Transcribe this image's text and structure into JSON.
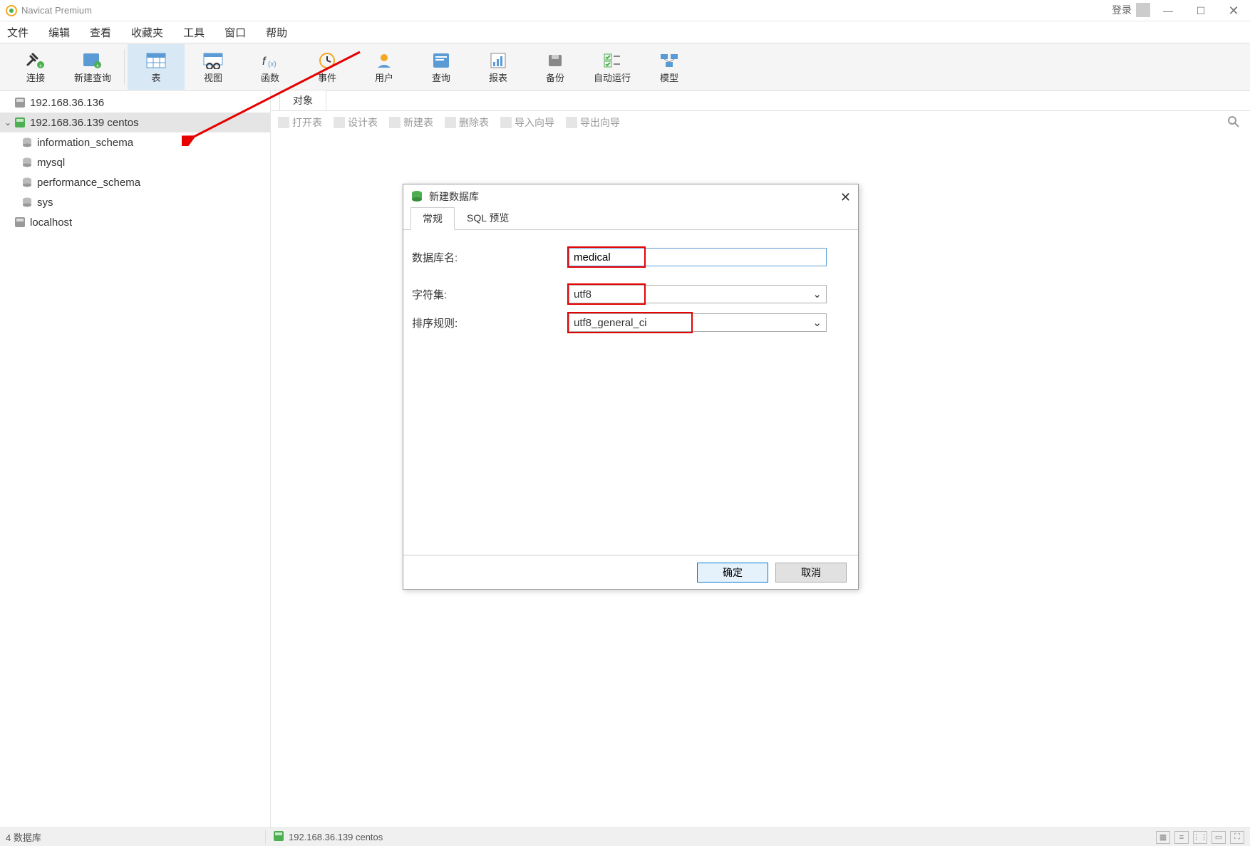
{
  "app": {
    "title": "Navicat Premium"
  },
  "login": {
    "label": "登录"
  },
  "menu": {
    "file": "文件",
    "edit": "编辑",
    "view": "查看",
    "fav": "收藏夹",
    "tools": "工具",
    "window": "窗口",
    "help": "帮助"
  },
  "toolbar": {
    "connect": "连接",
    "newquery": "新建查询",
    "table": "表",
    "view": "视图",
    "function": "函数",
    "event": "事件",
    "user": "用户",
    "query": "查询",
    "report": "报表",
    "backup": "备份",
    "autorun": "自动运行",
    "model": "模型"
  },
  "tree": {
    "conn1": "192.168.36.136",
    "conn2": "192.168.36.139  centos",
    "dbs": [
      "information_schema",
      "mysql",
      "performance_schema",
      "sys"
    ],
    "conn3": "localhost"
  },
  "objtab": "对象",
  "objtoolbar": {
    "open": "打开表",
    "design": "设计表",
    "new": "新建表",
    "delete": "删除表",
    "import": "导入向导",
    "export": "导出向导"
  },
  "dialog": {
    "title": "新建数据库",
    "tabs": {
      "general": "常规",
      "sql": "SQL 预览"
    },
    "labels": {
      "dbname": "数据库名:",
      "charset": "字符集:",
      "collation": "排序规则:"
    },
    "values": {
      "dbname": "medical",
      "charset": "utf8",
      "collation": "utf8_general_ci"
    },
    "buttons": {
      "ok": "确定",
      "cancel": "取消"
    }
  },
  "status": {
    "left": "4 数据库",
    "conn": "192.168.36.139  centos"
  }
}
